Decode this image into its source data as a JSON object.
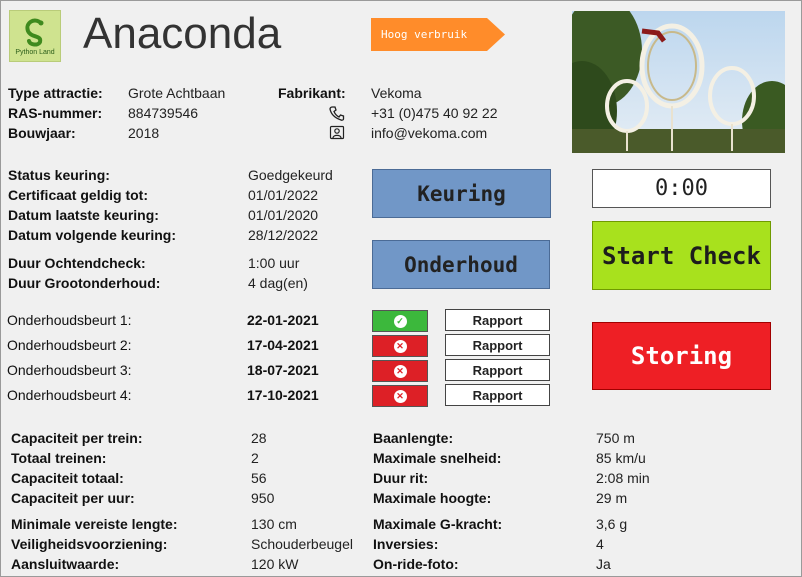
{
  "header": {
    "logo_text": "Python Land",
    "title": "Anaconda",
    "badge": "Hoog verbruik"
  },
  "info": {
    "type_label": "Type attractie:",
    "type_value": "Grote Achtbaan",
    "ras_label": "RAS-nummer:",
    "ras_value": "884739546",
    "year_label": "Bouwjaar:",
    "year_value": "2018",
    "maker_label": "Fabrikant:",
    "maker_value": "Vekoma",
    "phone": "+31 (0)475 40 92 22",
    "email": "info@vekoma.com"
  },
  "inspection": {
    "status_label": "Status keuring:",
    "status_value": "Goedgekeurd",
    "cert_label": "Certificaat geldig tot:",
    "cert_value": "01/01/2022",
    "last_label": "Datum laatste keuring:",
    "last_value": "01/01/2020",
    "next_label": "Datum volgende keuring:",
    "next_value": "28/12/2022",
    "morning_label": "Duur Ochtendcheck:",
    "morning_value": "1:00 uur",
    "major_label": "Duur Grootonderhoud:",
    "major_value": "4 dag(en)"
  },
  "buttons": {
    "keuring": "Keuring",
    "onderhoud": "Onderhoud",
    "timer": "0:00",
    "start_check": "Start Check",
    "storing": "Storing"
  },
  "maintenance": [
    {
      "label": "Onderhoudsbeurt 1:",
      "date": "22-01-2021",
      "status": "ok",
      "color": "#3cb83c",
      "rapport": "Rapport"
    },
    {
      "label": "Onderhoudsbeurt 2:",
      "date": "17-04-2021",
      "status": "fail",
      "color": "#dd2026",
      "rapport": "Rapport"
    },
    {
      "label": "Onderhoudsbeurt 3:",
      "date": "18-07-2021",
      "status": "fail",
      "color": "#dd2026",
      "rapport": "Rapport"
    },
    {
      "label": "Onderhoudsbeurt 4:",
      "date": "17-10-2021",
      "status": "fail",
      "color": "#dd2026",
      "rapport": "Rapport"
    }
  ],
  "specs_left": [
    {
      "label": "Capaciteit per trein:",
      "value": "28"
    },
    {
      "label": "Totaal treinen:",
      "value": "2"
    },
    {
      "label": "Capaciteit totaal:",
      "value": "56"
    },
    {
      "label": "Capaciteit per uur:",
      "value": "950"
    },
    {
      "label": "Minimale vereiste lengte:",
      "value": "130 cm"
    },
    {
      "label": "Veiligheidsvoorziening:",
      "value": "Schouderbeugel"
    },
    {
      "label": "Aansluitwaarde:",
      "value": "120 kW"
    }
  ],
  "specs_right": [
    {
      "label": "Baanlengte:",
      "value": "750 m"
    },
    {
      "label": "Maximale snelheid:",
      "value": "85 km/u"
    },
    {
      "label": "Duur rit:",
      "value": "2:08 min"
    },
    {
      "label": "Maximale hoogte:",
      "value": "29 m"
    },
    {
      "label": "Maximale G-kracht:",
      "value": "3,6 g"
    },
    {
      "label": "Inversies:",
      "value": "4"
    },
    {
      "label": "On-ride-foto:",
      "value": "Ja"
    }
  ],
  "colors": {
    "badge": "#ff8c2a",
    "button_blue": "#7197c7",
    "start_green": "#a8e11d",
    "storing_red": "#ee1f25"
  }
}
